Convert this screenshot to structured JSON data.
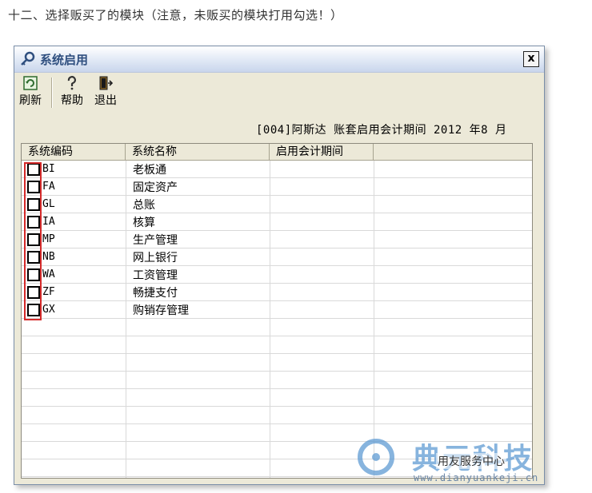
{
  "caption": "十二、选择贩买了的模块（注意，未贩买的模块打用勾选！）",
  "window": {
    "title": "系统启用",
    "close_label": "x"
  },
  "toolbar": {
    "refresh_label": "刷新",
    "help_label": "帮助",
    "exit_label": "退出"
  },
  "period_text": "[004]阿斯达 账套启用会计期间 2012 年8 月",
  "table": {
    "columns": [
      "系统编码",
      "系统名称",
      "启用会计期间"
    ],
    "rows": [
      {
        "code": "BI",
        "name": "老板通",
        "checked": false
      },
      {
        "code": "FA",
        "name": "固定资产",
        "checked": false
      },
      {
        "code": "GL",
        "name": "总账",
        "checked": false
      },
      {
        "code": "IA",
        "name": "核算",
        "checked": false
      },
      {
        "code": "MP",
        "name": "生产管理",
        "checked": false
      },
      {
        "code": "NB",
        "name": "网上银行",
        "checked": false
      },
      {
        "code": "WA",
        "name": "工资管理",
        "checked": false
      },
      {
        "code": "ZF",
        "name": "畅捷支付",
        "checked": false
      },
      {
        "code": "GX",
        "name": "购销存管理",
        "checked": false
      }
    ]
  },
  "watermark": {
    "brand": "典元科技",
    "subtitle": "用友服务中心",
    "url": "www.dianyuankeji.cn"
  },
  "colors": {
    "highlight": "#d42a2a",
    "window_bg": "#ece9d8",
    "watermark_blue": "#5f9bd3"
  }
}
